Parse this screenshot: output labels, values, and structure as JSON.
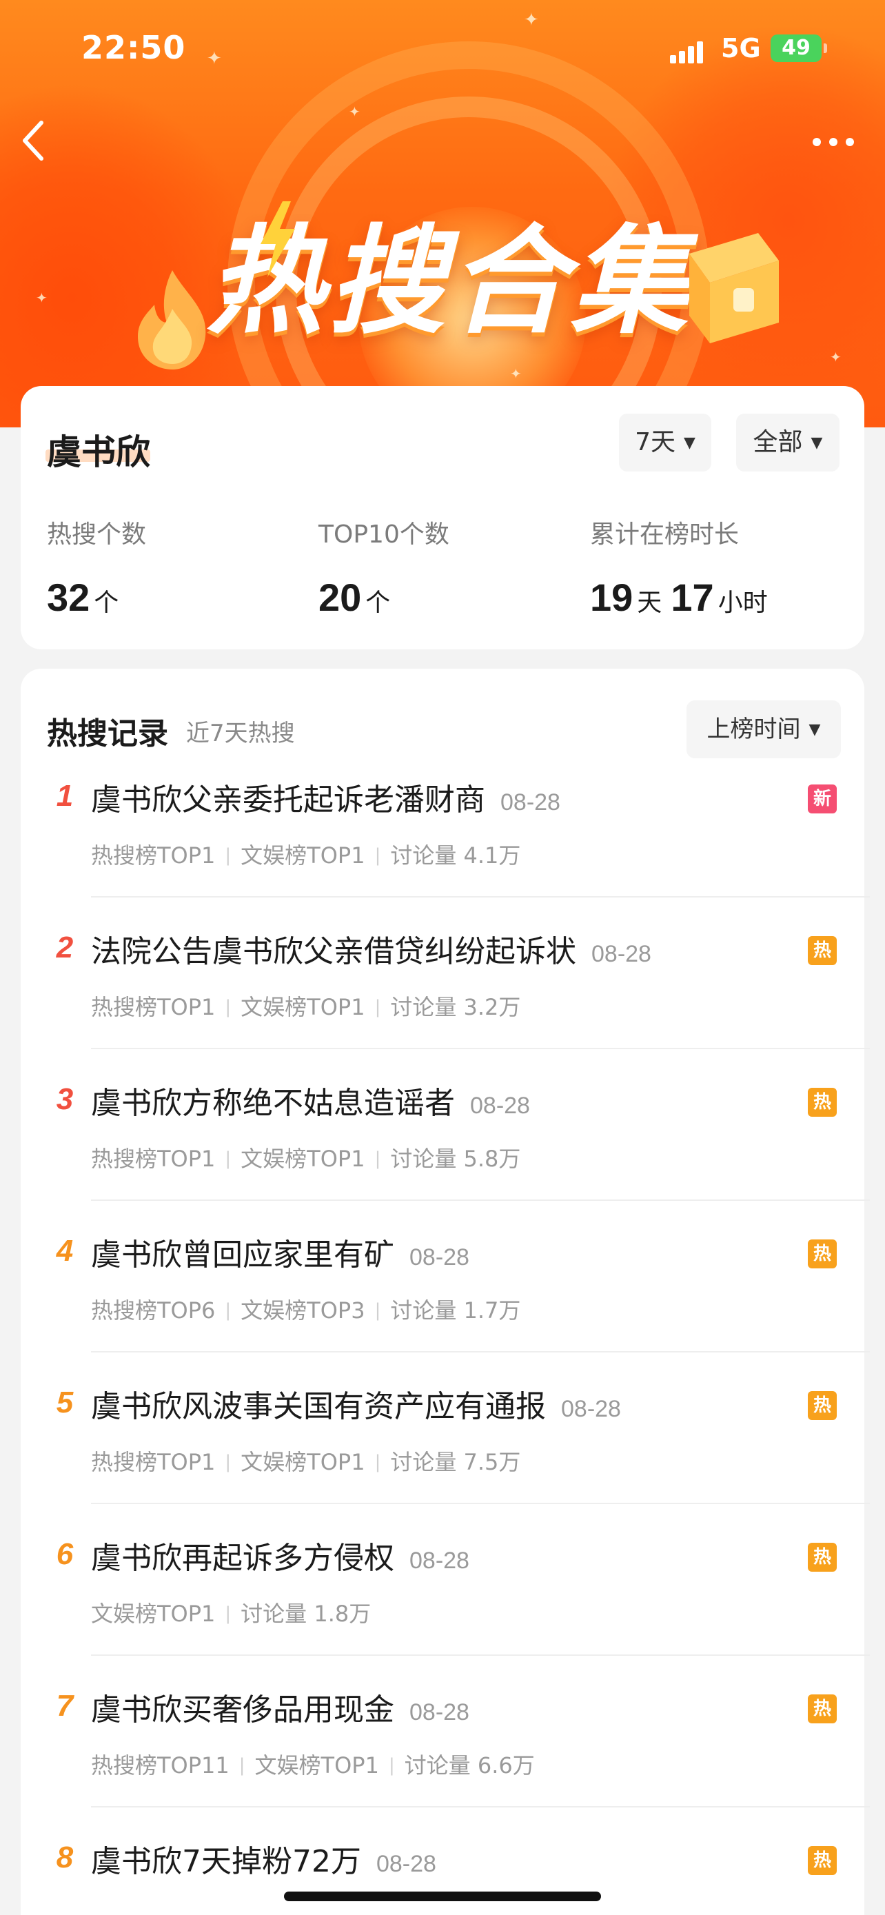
{
  "status_bar": {
    "time": "22:50",
    "network": "5G",
    "battery": "49"
  },
  "header": {
    "title": "热搜合集",
    "back_icon": "chevron-left-icon",
    "more_icon": "more-dots-icon"
  },
  "profile": {
    "name": "虞书欣",
    "filters": {
      "days": "7天",
      "scope": "全部"
    },
    "stats": [
      {
        "label": "热搜个数",
        "num1": "32",
        "unit1": "个"
      },
      {
        "label": "TOP10个数",
        "num1": "20",
        "unit1": "个"
      },
      {
        "label": "累计在榜时长",
        "num1": "19",
        "unit1": "天",
        "num2": "17",
        "unit2": "小时"
      }
    ]
  },
  "records": {
    "title": "热搜记录",
    "subtitle": "近7天热搜",
    "sort_label": "上榜时间",
    "items": [
      {
        "rank": "1",
        "topic": "虞书欣父亲委托起诉老潘财商",
        "date": "08-28",
        "tags": [
          "热搜榜TOP1",
          "文娱榜TOP1",
          "讨论量 4.1万"
        ],
        "badge": "新",
        "badge_type": "new"
      },
      {
        "rank": "2",
        "topic": "法院公告虞书欣父亲借贷纠纷起诉状",
        "date": "08-28",
        "tags": [
          "热搜榜TOP1",
          "文娱榜TOP1",
          "讨论量 3.2万"
        ],
        "badge": "热",
        "badge_type": "hot"
      },
      {
        "rank": "3",
        "topic": "虞书欣方称绝不姑息造谣者",
        "date": "08-28",
        "tags": [
          "热搜榜TOP1",
          "文娱榜TOP1",
          "讨论量 5.8万"
        ],
        "badge": "热",
        "badge_type": "hot"
      },
      {
        "rank": "4",
        "topic": "虞书欣曾回应家里有矿",
        "date": "08-28",
        "tags": [
          "热搜榜TOP6",
          "文娱榜TOP3",
          "讨论量 1.7万"
        ],
        "badge": "热",
        "badge_type": "hot"
      },
      {
        "rank": "5",
        "topic": "虞书欣风波事关国有资产应有通报",
        "date": "08-28",
        "tags": [
          "热搜榜TOP1",
          "文娱榜TOP1",
          "讨论量 7.5万"
        ],
        "badge": "热",
        "badge_type": "hot"
      },
      {
        "rank": "6",
        "topic": "虞书欣再起诉多方侵权",
        "date": "08-28",
        "tags": [
          "文娱榜TOP1",
          "讨论量 1.8万"
        ],
        "badge": "热",
        "badge_type": "hot"
      },
      {
        "rank": "7",
        "topic": "虞书欣买奢侈品用现金",
        "date": "08-28",
        "tags": [
          "热搜榜TOP11",
          "文娱榜TOP1",
          "讨论量 6.6万"
        ],
        "badge": "热",
        "badge_type": "hot"
      },
      {
        "rank": "8",
        "topic": "虞书欣7天掉粉72万",
        "date": "08-28",
        "tags": [],
        "badge": "热",
        "badge_type": "hot"
      }
    ]
  }
}
